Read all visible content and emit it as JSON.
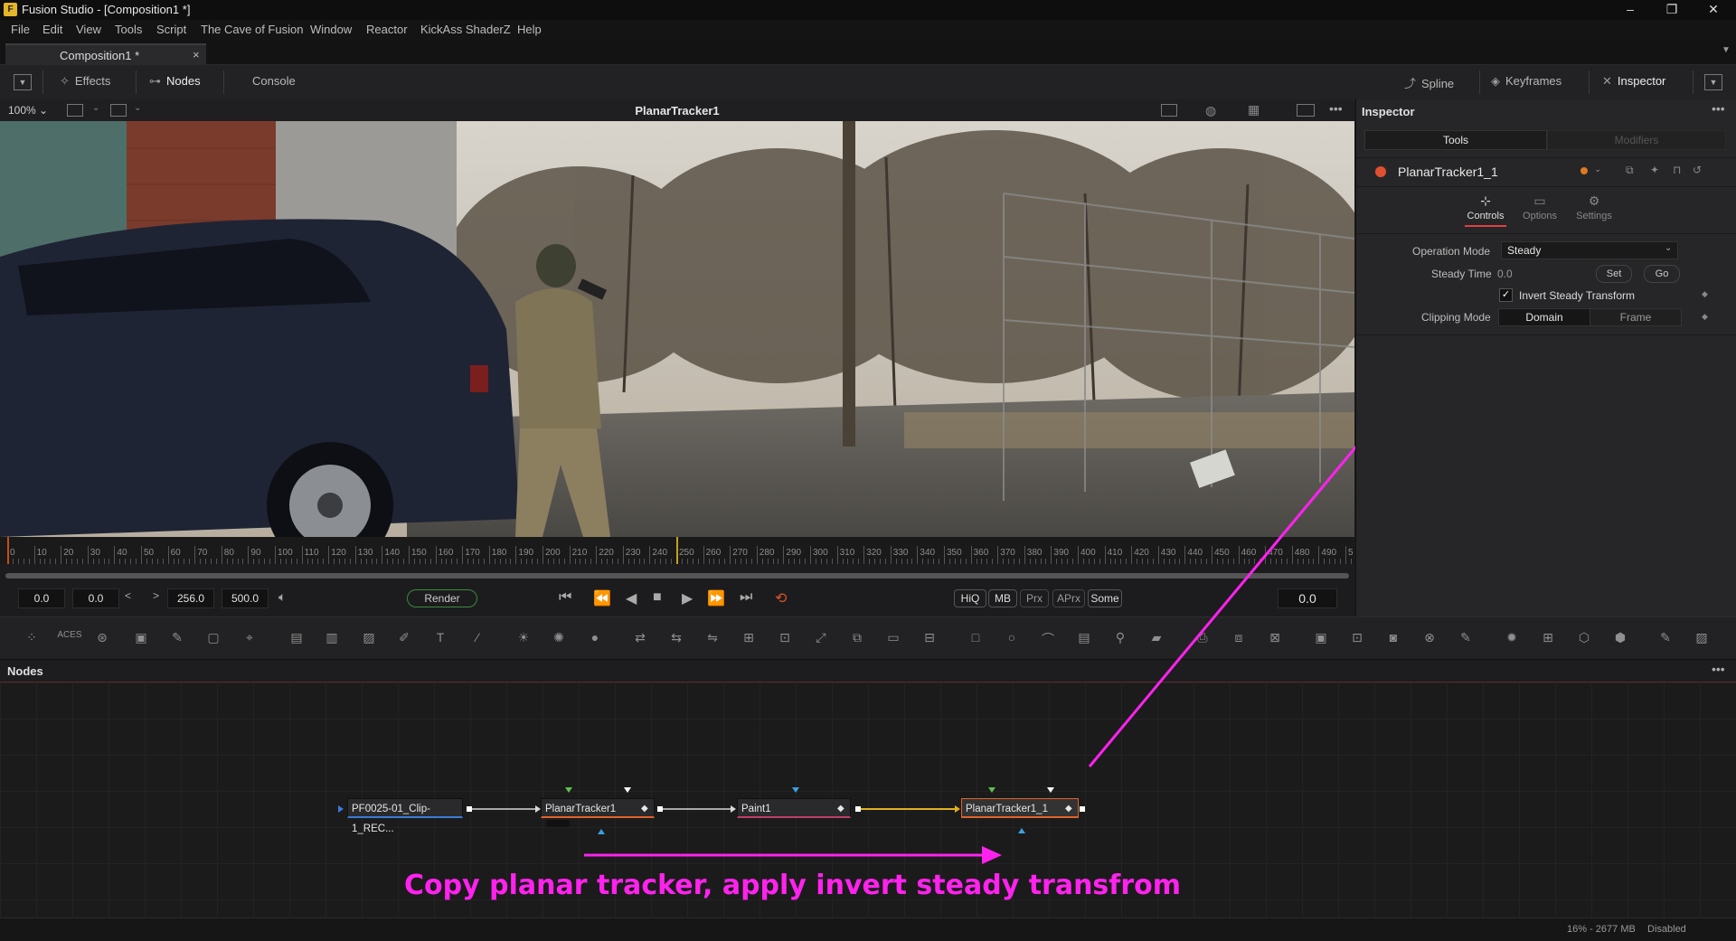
{
  "window": {
    "title": "Fusion Studio - [Composition1 *]",
    "logo_glyph": "F"
  },
  "menu": [
    "File",
    "Edit",
    "View",
    "Tools",
    "Script",
    "The Cave of Fusion",
    "Window",
    "Reactor",
    "KickAss ShaderZ",
    "Help"
  ],
  "tabs": [
    {
      "label": "Composition1 *",
      "close": "×"
    }
  ],
  "toolbar": {
    "left": [
      {
        "label": "Effects",
        "icon": "effects-icon"
      },
      {
        "label": "Nodes",
        "icon": "nodes-icon",
        "active": true
      },
      {
        "label": "Console"
      }
    ],
    "right": [
      {
        "label": "Spline",
        "icon": "spline-icon"
      },
      {
        "label": "Keyframes",
        "icon": "keyframes-icon"
      },
      {
        "label": "Inspector",
        "icon": "inspector-icon",
        "active": true
      }
    ]
  },
  "viewer": {
    "zoom": "100%",
    "title": "PlanarTracker1",
    "more": "•••"
  },
  "ruler": {
    "labels": [
      "0",
      "10",
      "20",
      "30",
      "40",
      "50",
      "60",
      "70",
      "80",
      "90",
      "100",
      "110",
      "120",
      "130",
      "140",
      "150",
      "160",
      "170",
      "180",
      "190",
      "200",
      "210",
      "220",
      "230",
      "240",
      "250",
      "260",
      "270",
      "280",
      "290",
      "300",
      "310",
      "320",
      "330",
      "340",
      "350",
      "360",
      "370",
      "380",
      "390",
      "400",
      "410",
      "420",
      "430",
      "440",
      "450",
      "460",
      "470",
      "480",
      "490",
      "5"
    ],
    "playhead_fraction": 0.5
  },
  "transport": {
    "global_start": "0.0",
    "render_start": "0.0",
    "render_end": "256.0",
    "global_end": "500.0",
    "render_label": "Render",
    "quality_buttons": [
      "HiQ",
      "MB",
      "Prx",
      "APrx",
      "Some"
    ],
    "current_time": "0.0"
  },
  "nodes_panel": {
    "title": "Nodes",
    "more": "•••",
    "nodes": [
      {
        "label": "PF0025-01_Clip-1_REC...",
        "color": "#3a7bd5"
      },
      {
        "label": "PlanarTracker1",
        "color": "#e0632a"
      },
      {
        "label": "Paint1",
        "color": "#c23b6b"
      },
      {
        "label": "PlanarTracker1_1",
        "color": "#e0632a",
        "selected": true
      }
    ]
  },
  "inspector": {
    "title": "Inspector",
    "more": "•••",
    "tabs": {
      "tools": "Tools",
      "modifiers": "Modifiers"
    },
    "tool_name": "PlanarTracker1_1",
    "subtabs": [
      "Controls",
      "Options",
      "Settings"
    ],
    "operation_mode": {
      "label": "Operation Mode",
      "value": "Steady"
    },
    "steady_time": {
      "label": "Steady Time",
      "value": "0.0",
      "set": "Set",
      "go": "Go"
    },
    "invert": {
      "label": "Invert Steady Transform",
      "checked": true
    },
    "clipping_mode": {
      "label": "Clipping Mode",
      "options": [
        "Domain",
        "Frame"
      ],
      "selected": "Domain"
    }
  },
  "status": {
    "memory": "16% - 2677 MB",
    "state": "Disabled"
  },
  "annotation": {
    "text": "Copy planar tracker, apply invert steady transfrom",
    "color": "#ff22ee"
  }
}
